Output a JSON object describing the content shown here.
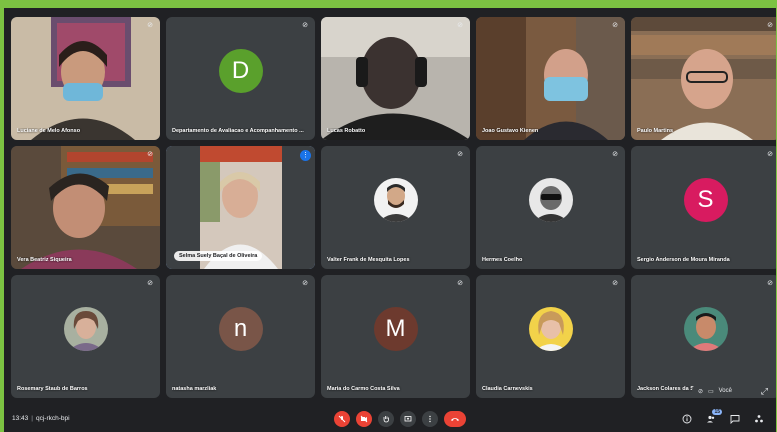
{
  "participants": [
    {
      "name": "Luciane de Melo Afonso",
      "type": "video"
    },
    {
      "name": "Departamento de Avaliacao e Acompanhamento ...",
      "type": "initial",
      "initial": "D",
      "color": "#5aa02c"
    },
    {
      "name": "Lucas Robatto",
      "type": "video"
    },
    {
      "name": "Joao Gustavo Kienen",
      "type": "video"
    },
    {
      "name": "Paulo Martins",
      "type": "video"
    },
    {
      "name": "Vera Beatriz Siqueira",
      "type": "video"
    },
    {
      "name": "Selma Suely Baçal de Oliveira",
      "type": "video",
      "active": true
    },
    {
      "name": "Valter Frank de Mesquita Lopes",
      "type": "photo"
    },
    {
      "name": "Hermes Coelho",
      "type": "photo"
    },
    {
      "name": "Sergio Anderson de Moura Miranda",
      "type": "initial",
      "initial": "S",
      "color": "#d81b60"
    },
    {
      "name": "Rosemary Staub de Barros",
      "type": "photo"
    },
    {
      "name": "natasha marzliak",
      "type": "initial",
      "initial": "n",
      "color": "#795548"
    },
    {
      "name": "Maria do Carmo Costa Silva",
      "type": "initial",
      "initial": "M",
      "color": "#6d3a2e"
    },
    {
      "name": "Claudia Carnevskis",
      "type": "photo"
    },
    {
      "name": "Jackson Colares da Silva",
      "type": "photo"
    }
  ],
  "bottom_bar": {
    "time": "13:43",
    "meeting_code": "qcj-rkch-bpi",
    "participant_count": "15"
  },
  "self_view": {
    "label": "Você"
  }
}
